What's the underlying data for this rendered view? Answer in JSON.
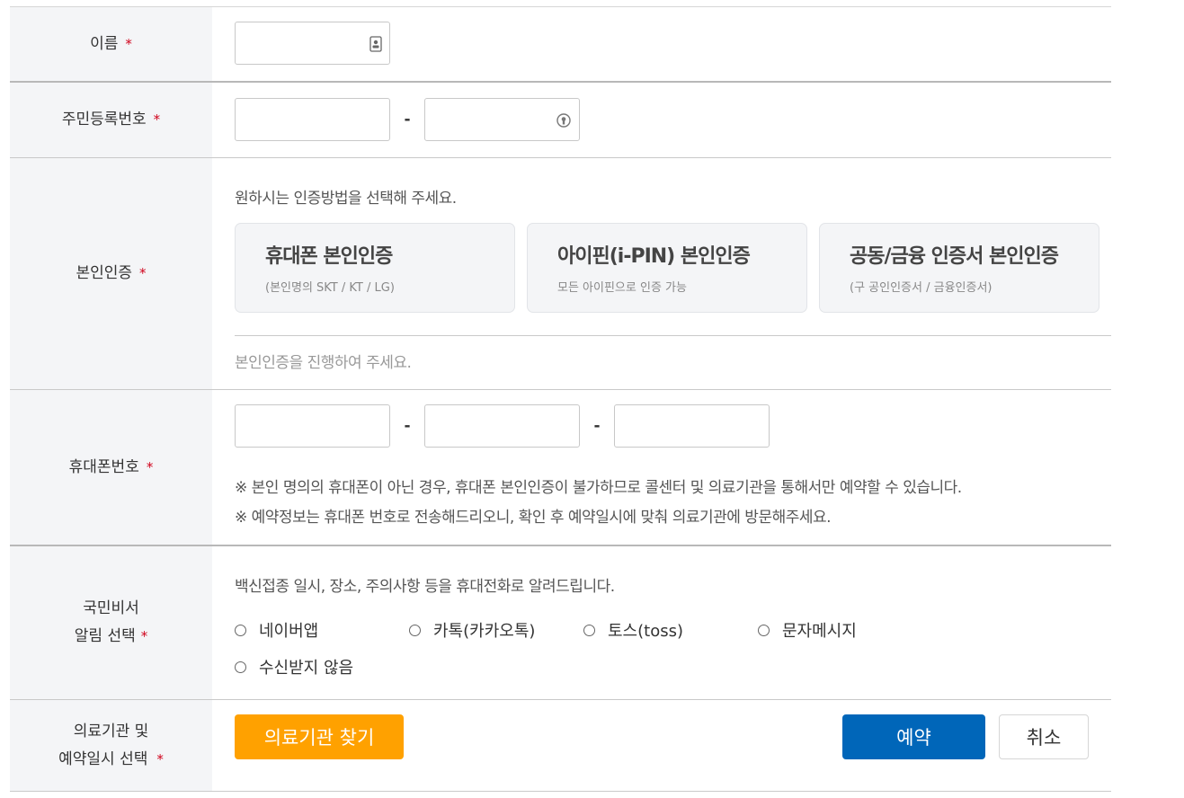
{
  "required_mark": "*",
  "name": {
    "label": "이름",
    "icon": "id-card-icon"
  },
  "rrn": {
    "label": "주민등록번호",
    "dash": "-",
    "icon": "keypad-icon"
  },
  "identity": {
    "label": "본인인증",
    "guide": "원하시는 인증방법을 선택해 주세요.",
    "methods": [
      {
        "title": "휴대폰 본인인증",
        "sub": "(본인명의 SKT / KT / LG)"
      },
      {
        "title": "아이핀(i-PIN) 본인인증",
        "sub": "모든 아이핀으로 인증 가능"
      },
      {
        "title": "공동/금융 인증서 본인인증",
        "sub": "(구 공인인증서 / 금융인증서)"
      }
    ],
    "status": "본인인증을 진행하여 주세요."
  },
  "phone": {
    "label": "휴대폰번호",
    "dash": "-",
    "notes": [
      "※ 본인 명의의 휴대폰이 아닌 경우, 휴대폰 본인인증이 불가하므로 콜센터 및 의료기관을 통해서만 예약할 수 있습니다.",
      "※ 예약정보는 휴대폰 번호로 전송해드리오니, 확인 후 예약일시에 맞춰 의료기관에 방문해주세요."
    ]
  },
  "notify": {
    "label_line1": "국민비서",
    "label_line2": "알림 선택",
    "guide": "백신접종 일시, 장소, 주의사항 등을 휴대전화로 알려드립니다.",
    "options": [
      "네이버앱",
      "카톡(카카오톡)",
      "토스(toss)",
      "문자메시지",
      "수신받지 않음"
    ]
  },
  "hospital": {
    "label_line1": "의료기관 및",
    "label_line2": "예약일시 선택",
    "find_button": "의료기관 찾기",
    "reserve_button": "예약",
    "cancel_button": "취소"
  },
  "colors": {
    "accent_orange": "#ffa100",
    "primary_blue": "#0066b9",
    "required_red": "#d0021b",
    "label_bg": "#f4f5f7"
  }
}
